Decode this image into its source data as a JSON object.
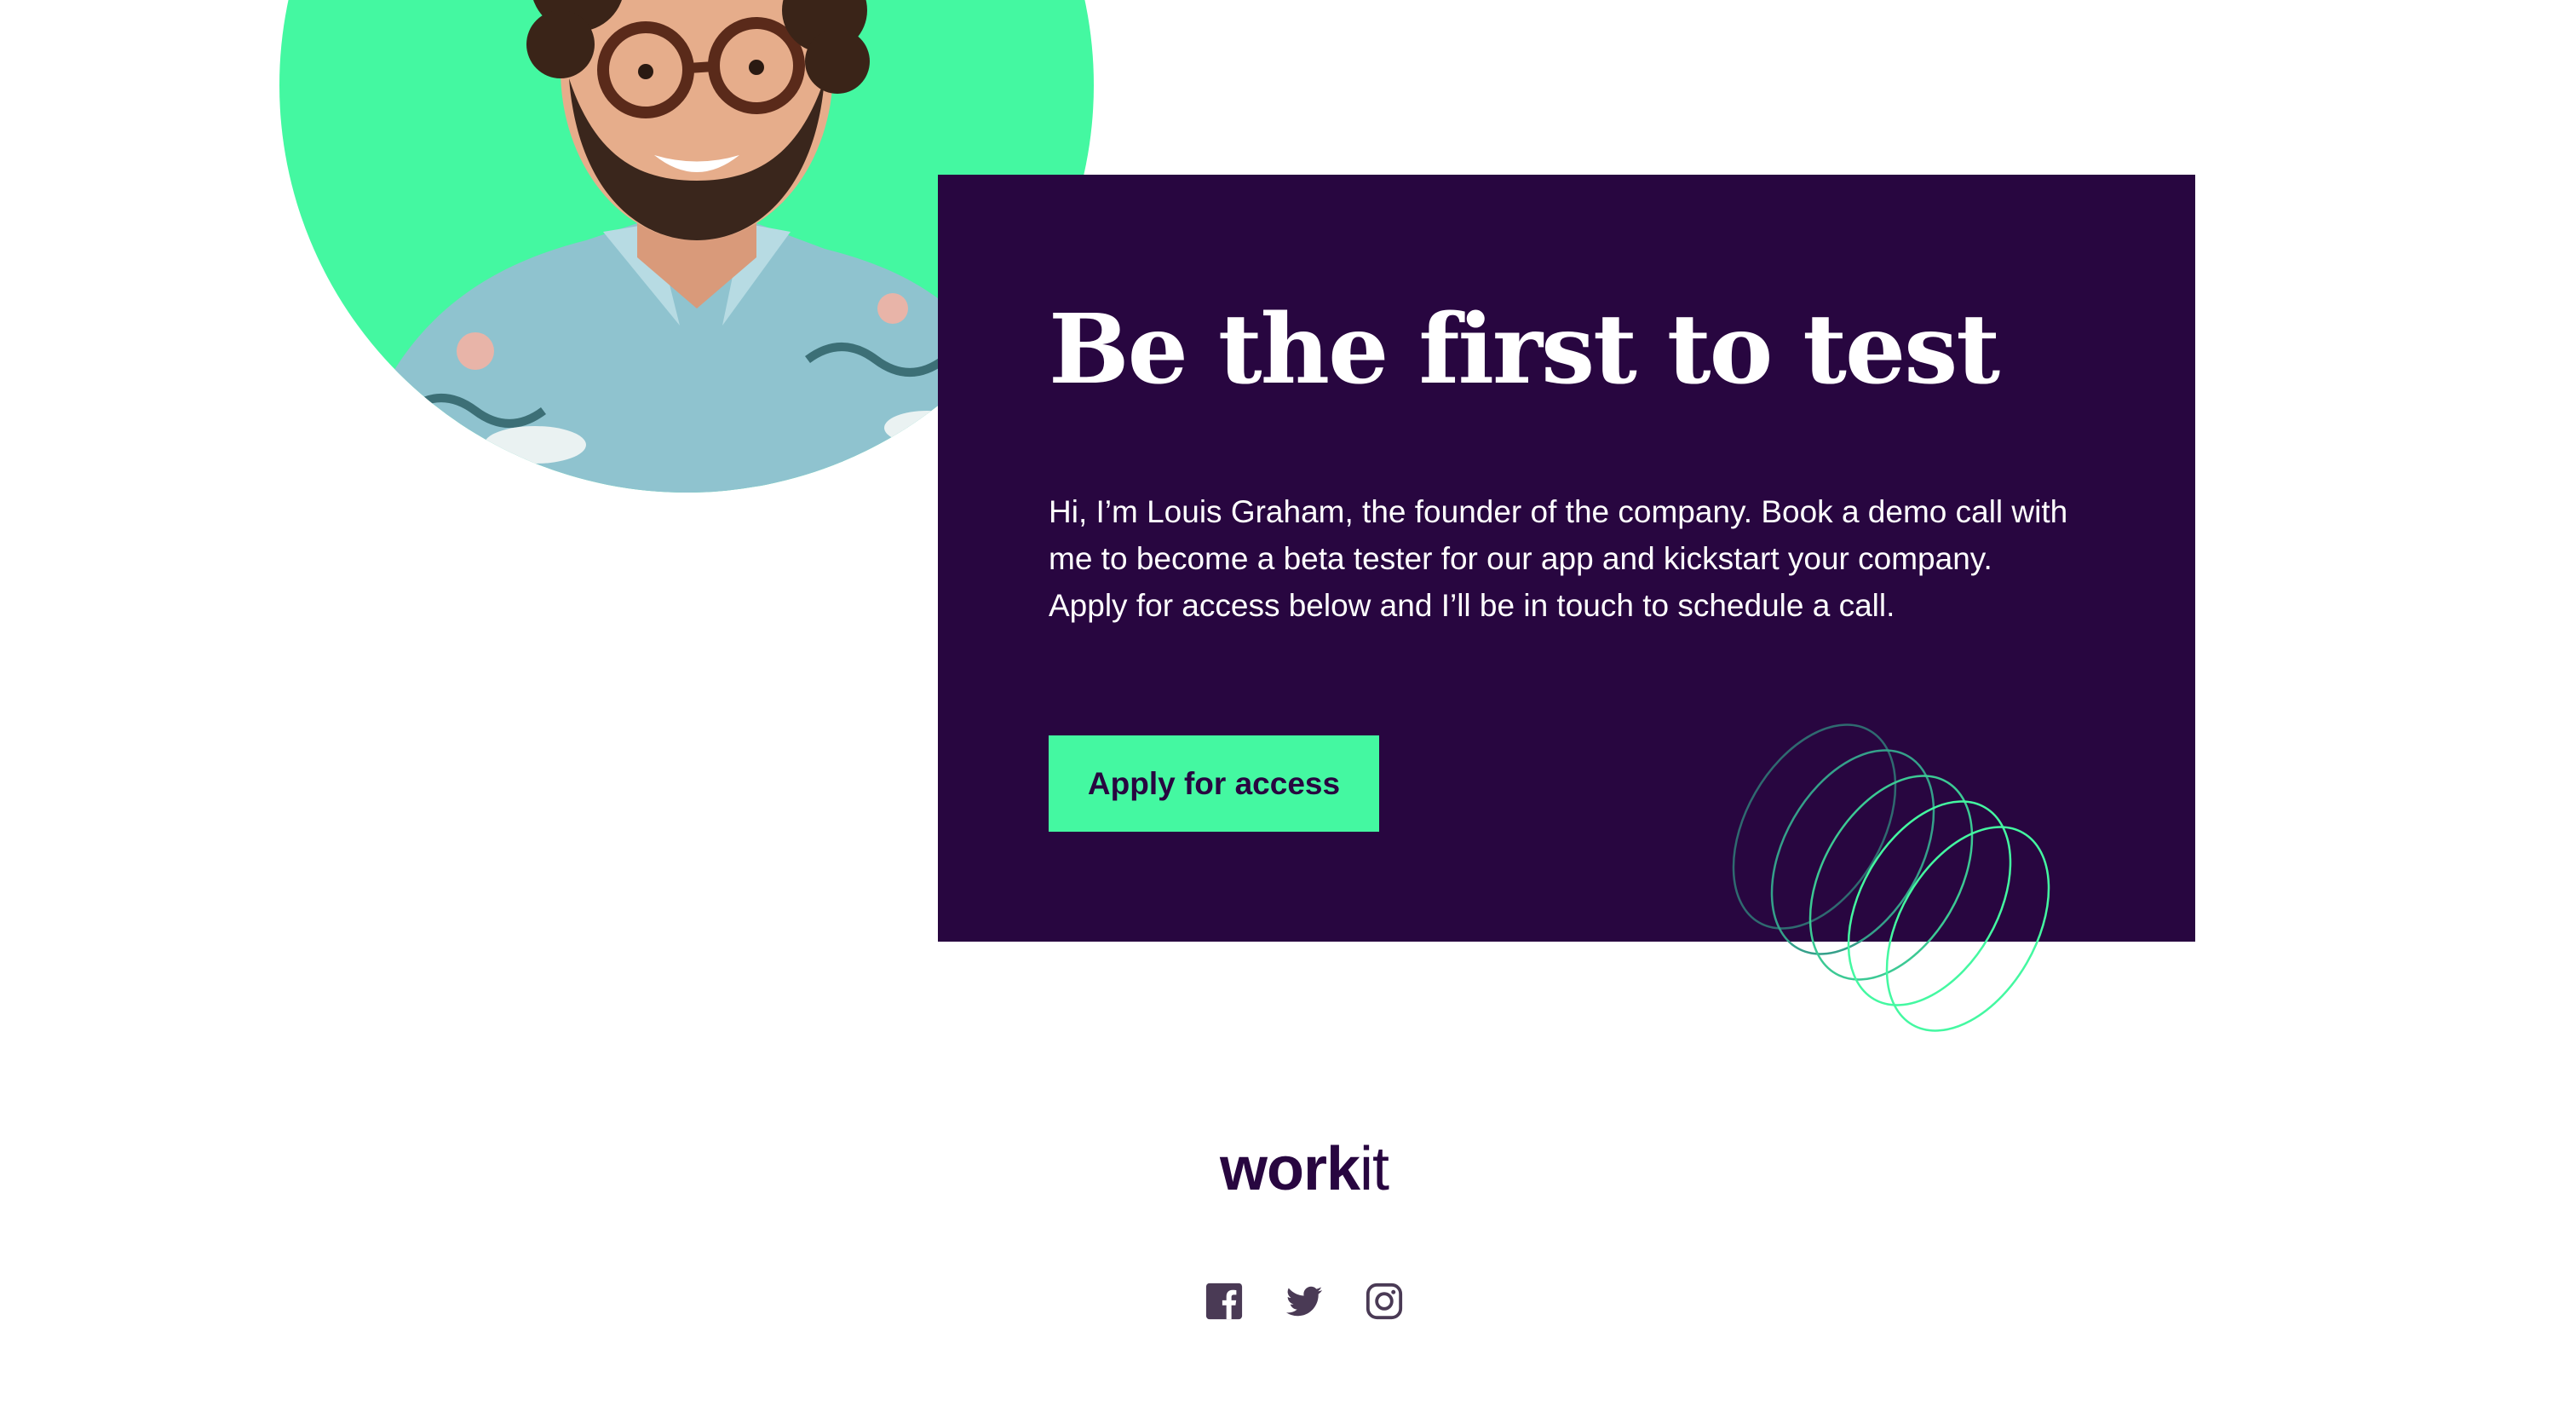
{
  "hero": {
    "title": "Be the first to test",
    "description_lines": [
      "Hi, I’m Louis Graham, the founder of the company. Book a demo call with",
      "me to become a beta tester for our app and kickstart your company.",
      "Apply for access below and I’ll be in touch to schedule a call."
    ],
    "cta_label": "Apply for access"
  },
  "footer": {
    "logo_bold": "work",
    "logo_light": "it",
    "social_icons": [
      "facebook-icon",
      "twitter-icon",
      "instagram-icon"
    ]
  },
  "colors": {
    "accent_green": "#44f8a1",
    "dark_purple": "#280640",
    "icon_gray": "#4a3a55",
    "background": "#ffffff"
  }
}
